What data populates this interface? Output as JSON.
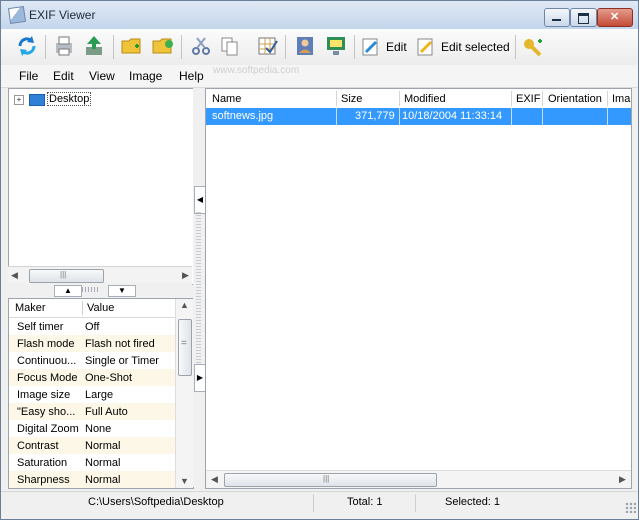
{
  "window": {
    "title": "EXIF Viewer"
  },
  "toolbar": {
    "edit_label": "Edit",
    "edit_selected_label": "Edit selected"
  },
  "menu": [
    "File",
    "Edit",
    "View",
    "Image",
    "Help"
  ],
  "watermark": "www.softpedia.com",
  "tree": {
    "root_label": "Desktop",
    "expander": "+"
  },
  "properties": {
    "headers": {
      "maker": "Maker",
      "value": "Value"
    },
    "rows": [
      {
        "name": "Self timer",
        "value": "Off"
      },
      {
        "name": "Flash mode",
        "value": "Flash not fired"
      },
      {
        "name": "Continuou...",
        "value": "Single or Timer"
      },
      {
        "name": "Focus Mode",
        "value": "One-Shot"
      },
      {
        "name": "Image size",
        "value": "Large"
      },
      {
        "name": "\"Easy sho...",
        "value": "Full Auto"
      },
      {
        "name": "Digital Zoom",
        "value": "None"
      },
      {
        "name": "Contrast",
        "value": "Normal"
      },
      {
        "name": "Saturation",
        "value": "Normal"
      },
      {
        "name": "Sharpness",
        "value": "Normal"
      }
    ]
  },
  "file_list": {
    "columns": [
      "Name",
      "Size",
      "Modified",
      "EXIF",
      "Orientation",
      "Ima"
    ],
    "rows": [
      {
        "name": "softnews.jpg",
        "size": "371,779",
        "modified": "10/18/2004 11:33:14",
        "exif": "",
        "orientation": "",
        "image": ""
      }
    ]
  },
  "status": {
    "path": "C:\\Users\\Softpedia\\Desktop",
    "total": "Total: 1",
    "selected": "Selected: 1"
  },
  "colors": {
    "selection": "#3399ff",
    "titlebar": "#dbe6f4",
    "window_bg": "#f0f0f0"
  },
  "icons": [
    "refresh-icon",
    "print-icon",
    "export-icon",
    "new-folder-icon",
    "open-folder-icon",
    "cut-icon",
    "copy-icon",
    "select-all-icon",
    "user-icon",
    "monitor-icon",
    "edit-icon",
    "edit-selected-icon",
    "add-key-icon"
  ]
}
